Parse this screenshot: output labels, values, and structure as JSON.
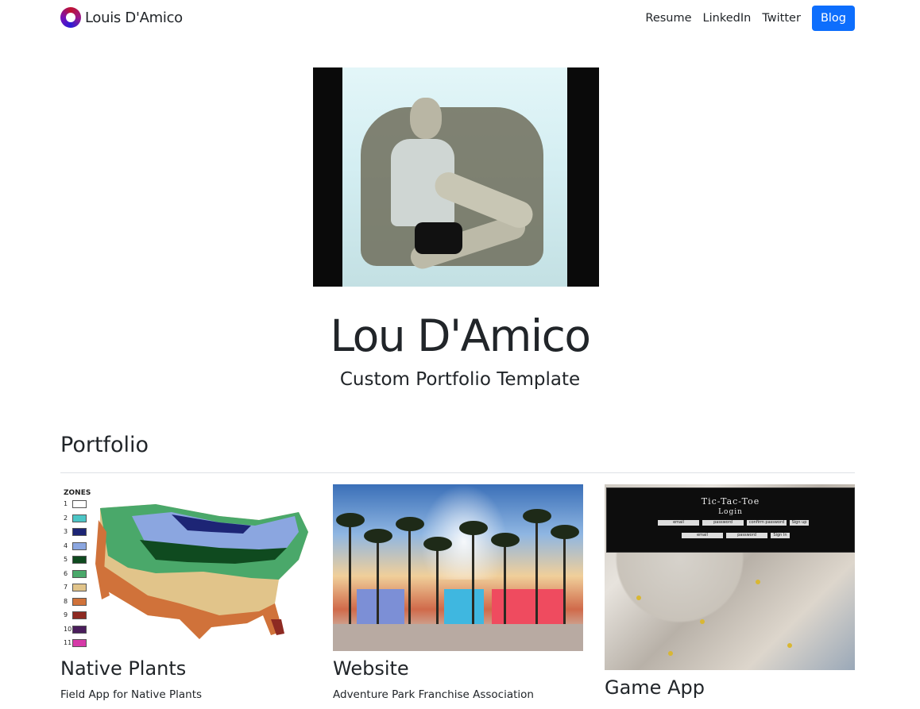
{
  "nav": {
    "brand": "Louis D'Amico",
    "links": [
      "Resume",
      "LinkedIn",
      "Twitter"
    ],
    "button": "Blog"
  },
  "hero": {
    "title": "Lou D'Amico",
    "subtitle": "Custom Portfolio Template"
  },
  "portfolio": {
    "heading": "Portfolio",
    "cards": [
      {
        "title": "Native Plants",
        "text": "Field App for Native Plants",
        "image": {
          "zones_label": "ZONES",
          "zones": [
            "1",
            "2",
            "3",
            "4",
            "5",
            "6",
            "7",
            "8",
            "9",
            "10",
            "11"
          ],
          "zone_colors": [
            "#ffffff",
            "#4cc6c6",
            "#1d2575",
            "#8ba6e0",
            "#0f4a1f",
            "#4aa86a",
            "#e1c48a",
            "#d0723a",
            "#8e2a22",
            "#4a1e5c",
            "#d63aa8"
          ]
        }
      },
      {
        "title": "Website",
        "text": "Adventure Park Franchise Association"
      },
      {
        "title": "Game App",
        "image": {
          "heading": "Tic-Tac-Toe",
          "sub": "Login",
          "row1": [
            "email",
            "password",
            "confirm password",
            "Sign up"
          ],
          "row2": [
            "email",
            "password",
            "Sign In"
          ]
        }
      }
    ]
  },
  "colors": {
    "primary": "#0d6efd",
    "text": "#212529",
    "divider": "#dee2e6"
  }
}
